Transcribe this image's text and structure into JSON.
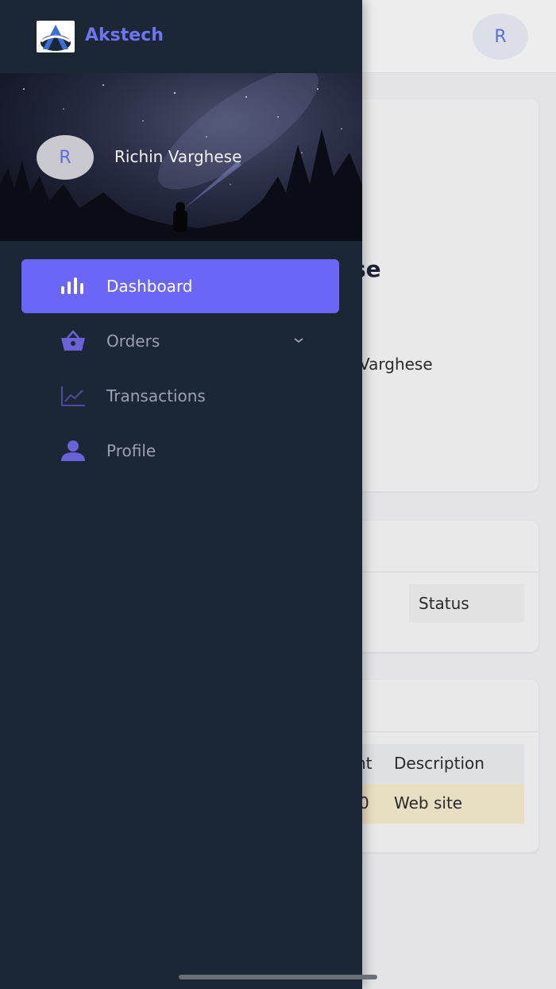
{
  "app": {
    "name": "Akstech"
  },
  "user": {
    "initial": "R",
    "name": "Richin Varghese"
  },
  "nav": {
    "items": [
      {
        "label": "Dashboard",
        "icon": "bar-chart-icon",
        "active": true
      },
      {
        "label": "Orders",
        "icon": "basket-icon",
        "expandable": true
      },
      {
        "label": "Transactions",
        "icon": "line-chart-icon"
      },
      {
        "label": "Profile",
        "icon": "person-icon"
      }
    ]
  },
  "background": {
    "topbar_avatar": "R",
    "card1_heading_fragment": "se",
    "card1_name_fragment": "Varghese",
    "card2_header": "Status",
    "card3_header_fragment": "nt",
    "card3_header": "Description",
    "card3_cell_fragment": "0",
    "card3_cell": "Web site"
  },
  "colors": {
    "drawer_bg": "#1c2736",
    "accent": "#6b66f8",
    "brand": "#6e74f0"
  }
}
